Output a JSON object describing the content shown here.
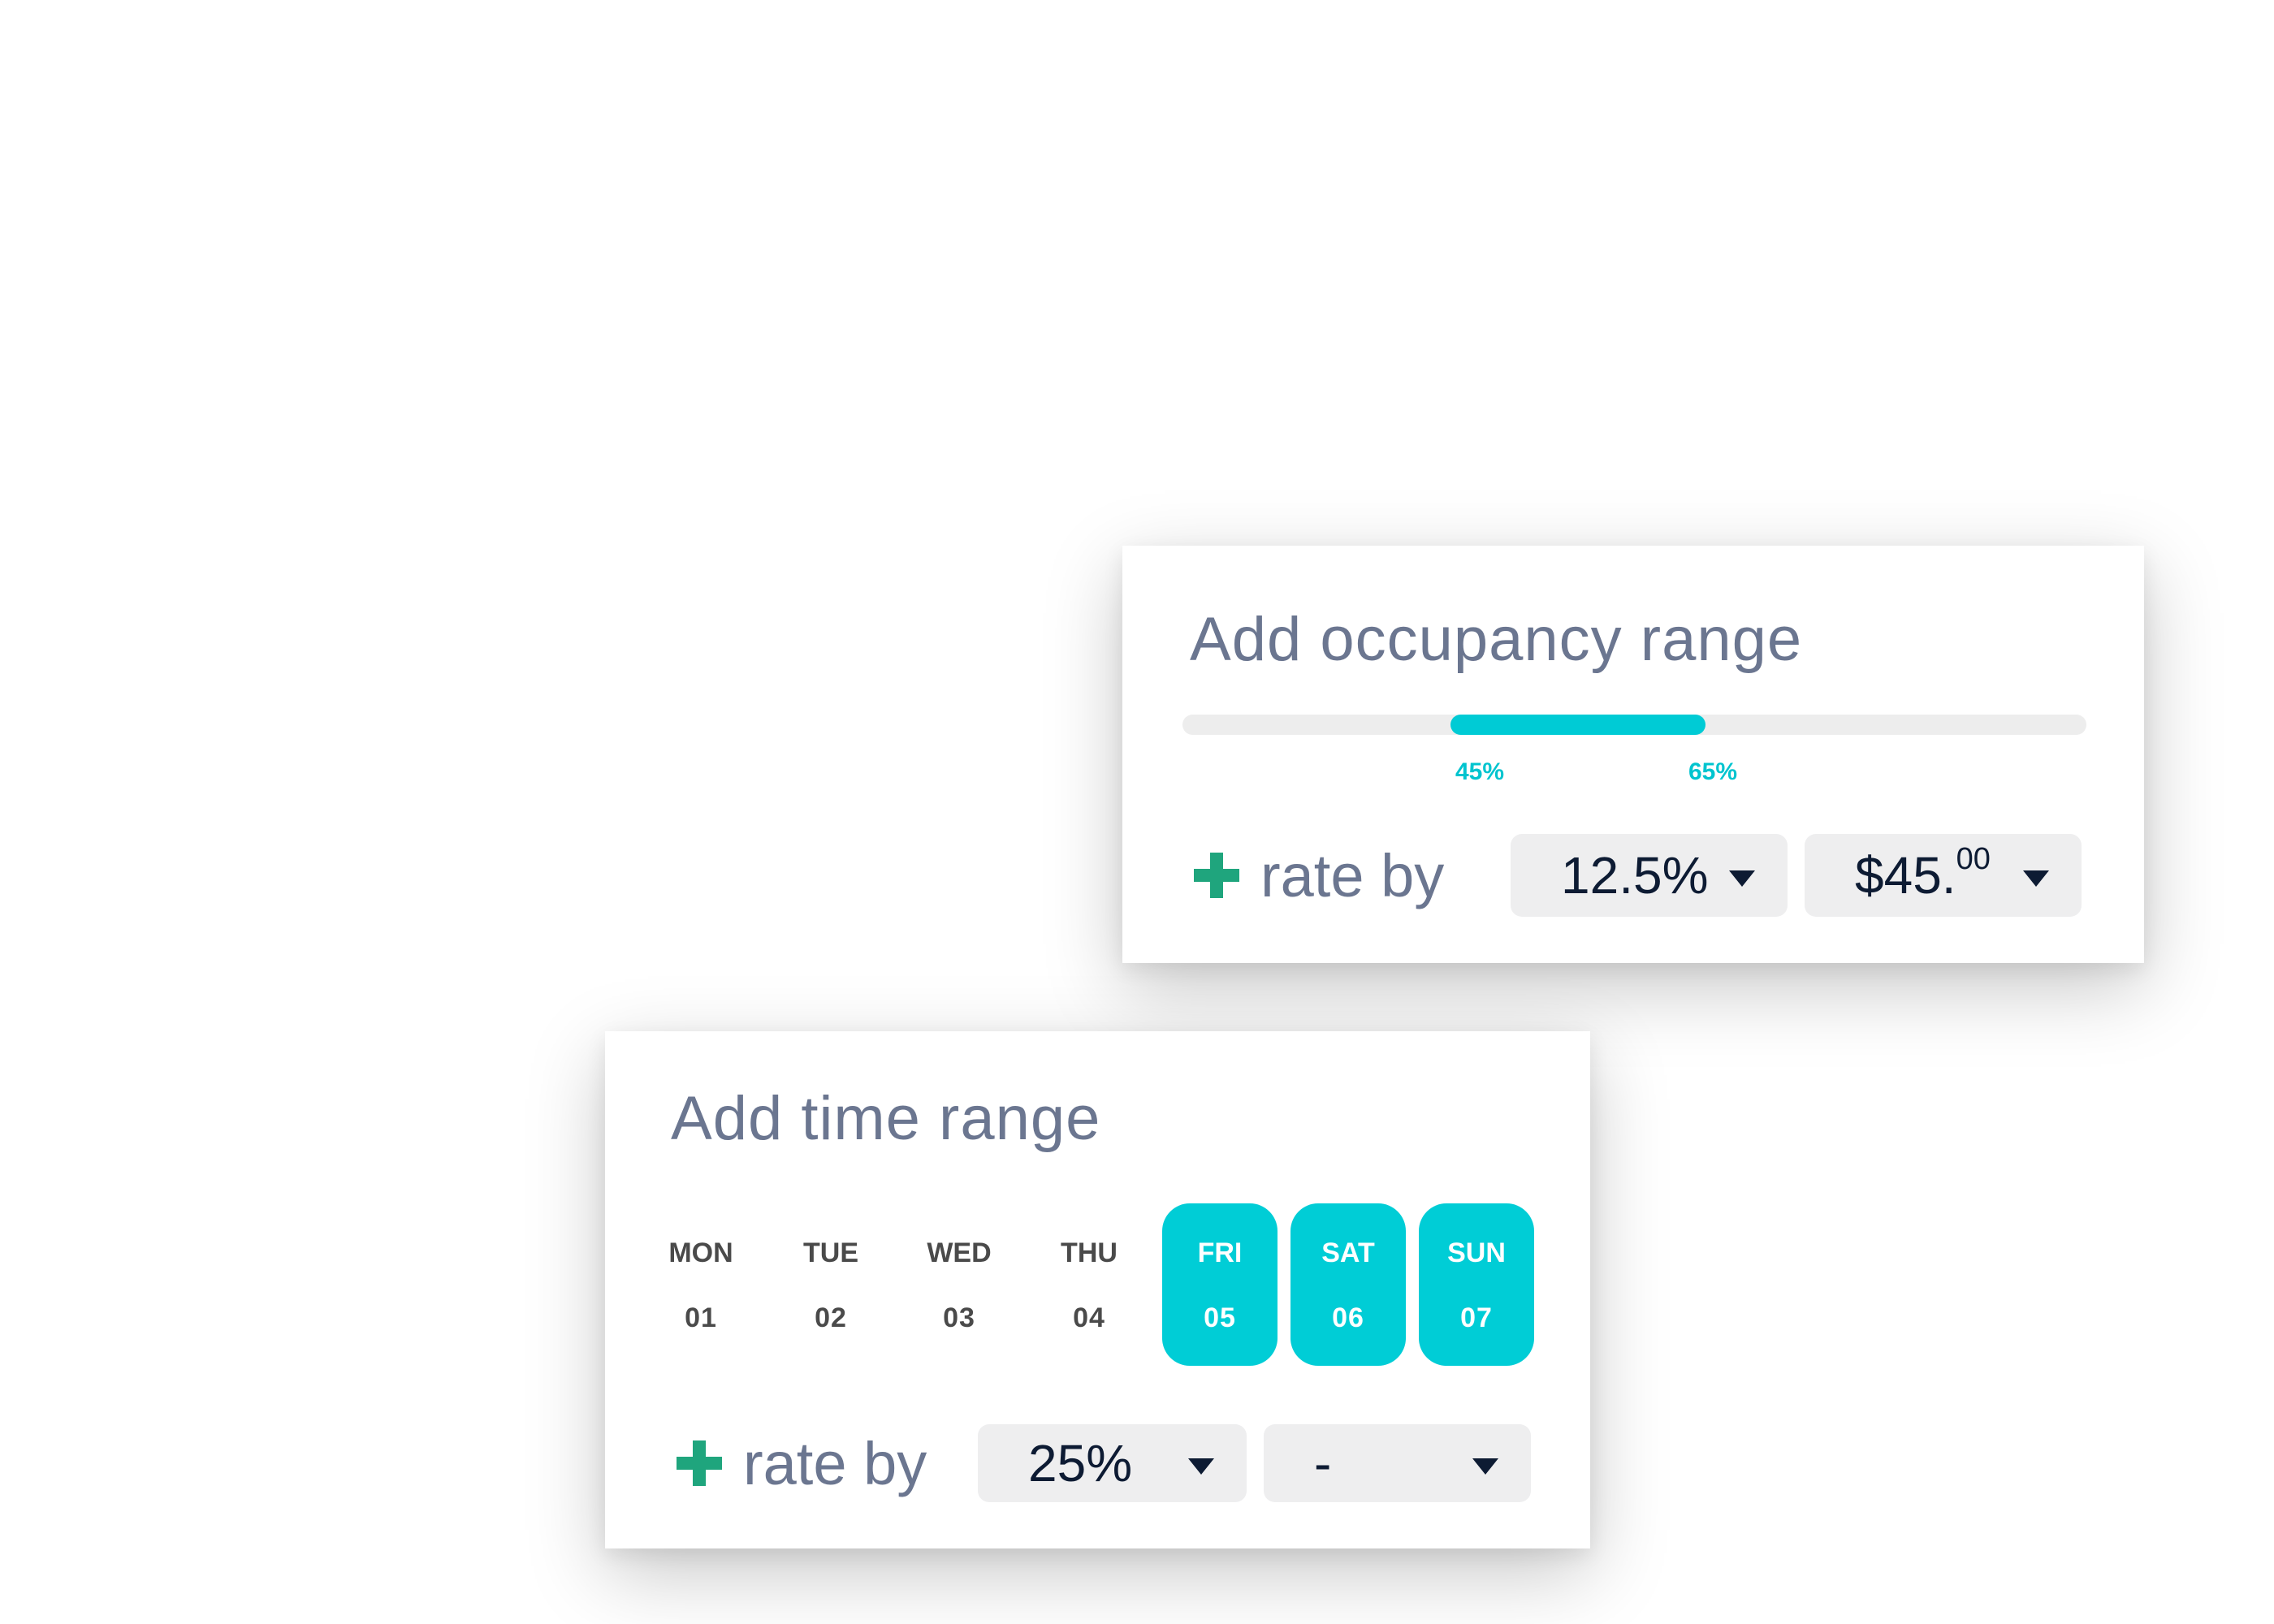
{
  "occupancy_card": {
    "title": "Add occupancy range",
    "range": {
      "min_percent": 0,
      "max_percent": 100,
      "low": 45,
      "high": 65,
      "low_label": "45%",
      "high_label": "65%"
    },
    "rate_label": "rate by",
    "dropdown_1": {
      "value": "12.5%"
    },
    "dropdown_2": {
      "value_main": "$45.",
      "value_cents": "00"
    }
  },
  "time_card": {
    "title": "Add time range",
    "days": [
      {
        "name": "MON",
        "num": "01",
        "selected": false
      },
      {
        "name": "TUE",
        "num": "02",
        "selected": false
      },
      {
        "name": "WED",
        "num": "03",
        "selected": false
      },
      {
        "name": "THU",
        "num": "04",
        "selected": false
      },
      {
        "name": "FRI",
        "num": "05",
        "selected": true
      },
      {
        "name": "SAT",
        "num": "06",
        "selected": true
      },
      {
        "name": "SUN",
        "num": "07",
        "selected": true
      }
    ],
    "rate_label": "rate by",
    "dropdown_1": {
      "value": "25%"
    },
    "dropdown_2": {
      "value": "-"
    }
  },
  "colors": {
    "accent": "#00cdd6",
    "plus": "#1fa57d",
    "title": "#6b7690",
    "dropdown_bg": "#eeeeef",
    "dark_text": "#0d1b33"
  }
}
